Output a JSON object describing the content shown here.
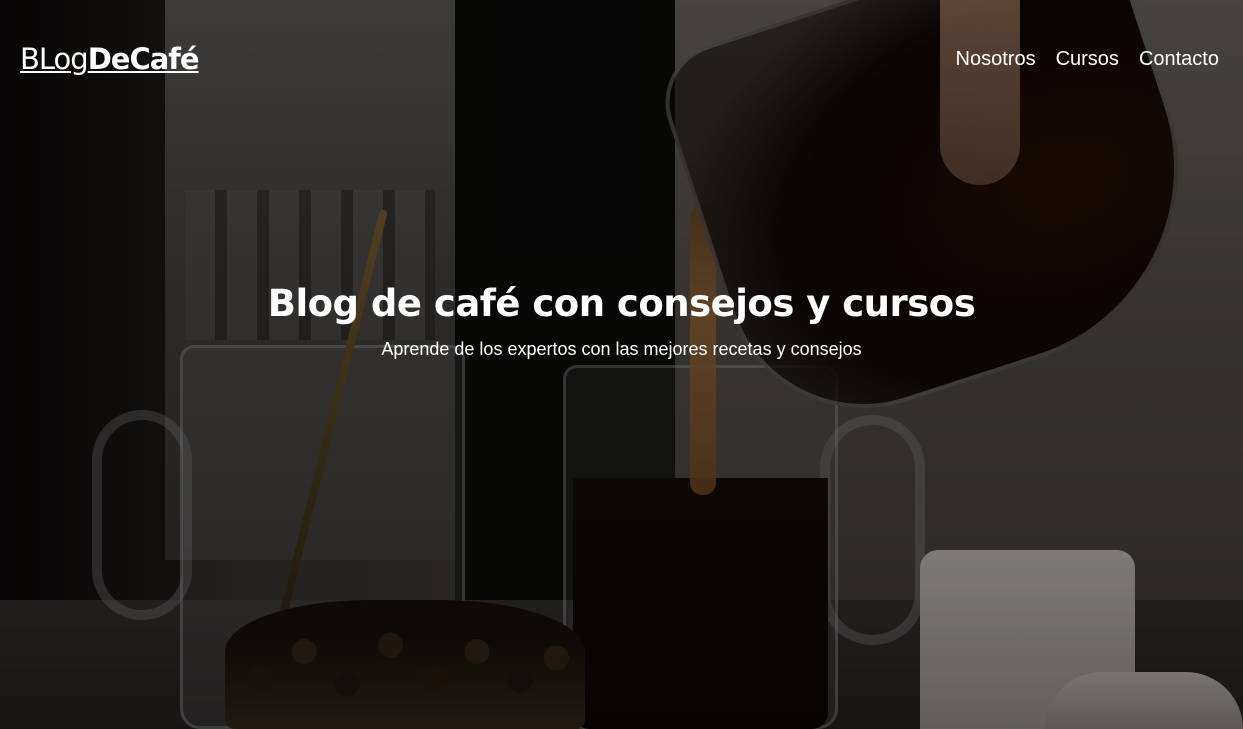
{
  "brand": {
    "logo_part1": "BLog",
    "logo_part2": "DeCafé"
  },
  "nav": {
    "items": [
      {
        "label": "Nosotros"
      },
      {
        "label": "Cursos"
      },
      {
        "label": "Contacto"
      }
    ]
  },
  "hero": {
    "title": "Blog de café con consejos y cursos",
    "subtitle": "Aprende de los expertos con las mejores recetas y consejos",
    "background_image": "coffee-pour-photo"
  },
  "colors": {
    "text": "#ffffff",
    "overlay": "#000000"
  }
}
